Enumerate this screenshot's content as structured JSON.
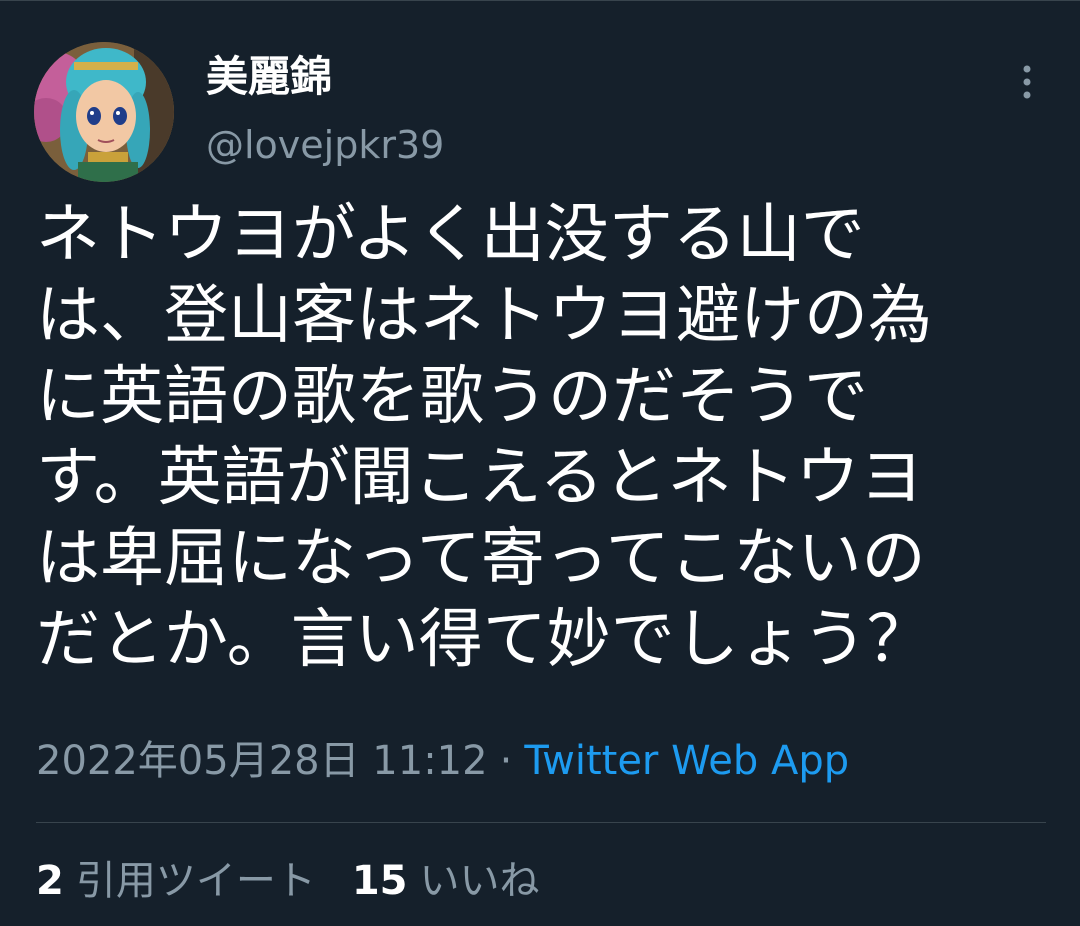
{
  "tweet": {
    "author": {
      "display_name": "美麗錦",
      "handle": "@lovejpkr39"
    },
    "text_lines": [
      "ネトウヨがよく出没する山で",
      "は、登山客はネトウヨ避けの為",
      "に英語の歌を歌うのだそうで",
      "す。英語が聞こえるとネトウヨ",
      "は卑屈になって寄ってこないの",
      "だとか。言い得て妙でしょう？"
    ],
    "timestamp": "2022年05月28日 11:12",
    "separator": "·",
    "source": "Twitter Web App",
    "stats": {
      "quote_count": "2",
      "quote_label": "引用ツイート",
      "like_count": "15",
      "like_label": "いいね"
    }
  },
  "theme": {
    "background": "#15202b",
    "primary_text": "#ffffff",
    "secondary_text": "#8899a6",
    "link": "#1d9bf0",
    "divider": "#38444d"
  },
  "icons": {
    "more": "more-vertical-icon"
  }
}
